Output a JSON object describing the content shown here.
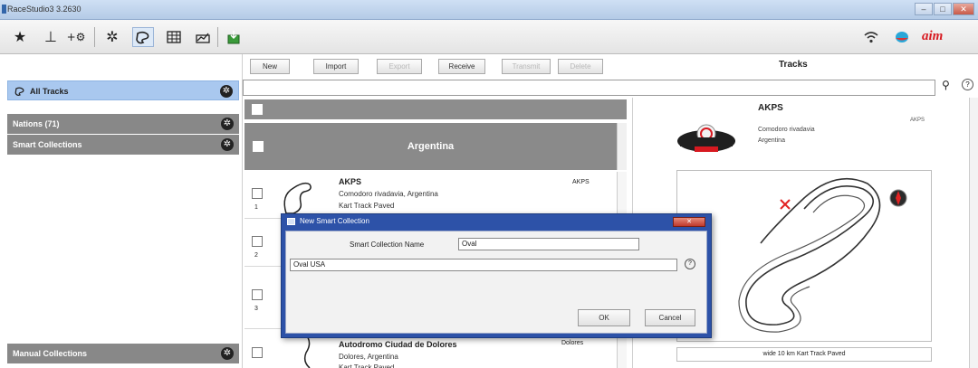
{
  "window": {
    "title": "RaceStudio3 3.2630"
  },
  "toolbar": {
    "icons": [
      "star-icon",
      "upload-icon",
      "add-device-icon",
      "gear-icon",
      "tracks-icon",
      "grid-icon",
      "chart-icon",
      "download-icon"
    ],
    "right_icons": [
      "wifi-icon",
      "status-icon",
      "aim-logo"
    ],
    "brand": "aim"
  },
  "sidebar": {
    "all_tracks": "All Tracks",
    "nations": "Nations (71)",
    "smart_collections": "Smart Collections",
    "manual_collections": "Manual Collections"
  },
  "actions": {
    "new": "New",
    "import": "Import",
    "export": "Export",
    "receive": "Receive",
    "transmit": "Transmit",
    "delete": "Delete"
  },
  "right_header": {
    "title": "Tracks"
  },
  "list": {
    "group": "Argentina",
    "rows": [
      {
        "index": "1",
        "name": "AKPS",
        "location": "Comodoro rivadavia, Argentina",
        "type": "Kart Track Paved",
        "code": "AKPS"
      },
      {
        "index": "2",
        "name": "",
        "location": "",
        "type": "",
        "code": ""
      },
      {
        "index": "3",
        "name": "",
        "location": "",
        "type": "",
        "code": ""
      },
      {
        "index": "",
        "name": "Autodromo Ciudad de Dolores",
        "location": "Dolores, Argentina",
        "type": "Kart Track Paved",
        "code": "Dolores"
      }
    ]
  },
  "detail": {
    "name": "AKPS",
    "code": "AKPS",
    "city": "Comodoro rivadavia",
    "country": "Argentina",
    "footer": "wide 10 km Kart Track Paved"
  },
  "dialog": {
    "title": "New Smart Collection",
    "name_label": "Smart Collection Name",
    "name_value": "Oval",
    "filter_value": "Oval USA",
    "ok": "OK",
    "cancel": "Cancel"
  },
  "colors": {
    "selected_row": "#a9c8ef",
    "group_grey": "#8a8a8a",
    "dialog_blue": "#2d52a8",
    "brand_red": "#d71920",
    "start_mark": "#e22222"
  }
}
